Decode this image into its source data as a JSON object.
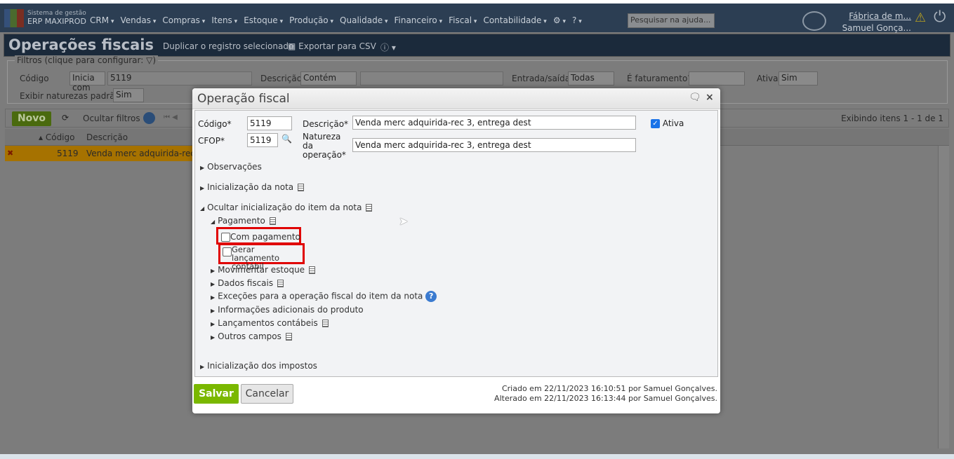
{
  "app": {
    "brand_line1": "Sistema de gestão",
    "brand_line2": "ERP MAXIPROD"
  },
  "nav": {
    "menus": [
      "CRM",
      "Vendas",
      "Compras",
      "Itens",
      "Estoque",
      "Produção",
      "Qualidade",
      "Financeiro",
      "Fiscal",
      "Contabilidade"
    ],
    "help_search_placeholder": "Pesquisar na ajuda...",
    "company": "Fábrica de m...",
    "user": "Samuel Gonça..."
  },
  "page": {
    "title": "Operações fiscais",
    "duplicate": "Duplicar o registro selecionado",
    "export_csv": "Exportar para CSV"
  },
  "filters": {
    "legend": "Filtros (clique para configurar:",
    "codigo_label": "Código",
    "codigo_op": "Inicia com",
    "codigo_value": "5119",
    "descricao_label": "Descrição",
    "descricao_op": "Contém",
    "descricao_value": "",
    "entrada_label": "Entrada/saída",
    "entrada_value": "Todas",
    "faturamento_label": "É faturamento?",
    "faturamento_value": "",
    "ativa_label": "Ativa",
    "ativa_value": "Sim",
    "naturezas_label": "Exibir naturezas padrão",
    "naturezas_value": "Sim"
  },
  "toolbar": {
    "novo": "Novo",
    "hide_filters": "Ocultar filtros",
    "paging": "Exibindo itens 1 - 1 de 1"
  },
  "grid": {
    "columns": [
      "Código",
      "Descrição"
    ],
    "rows": [
      {
        "codigo": "5119",
        "descricao": "Venda merc adquirida-rec 3"
      }
    ]
  },
  "modal": {
    "title": "Operação fiscal",
    "codigo_label": "Código*",
    "codigo": "5119",
    "cfop_label": "CFOP*",
    "cfop": "5119",
    "descricao_label": "Descrição*",
    "descricao": "Venda merc adquirida-rec 3, entrega dest",
    "natureza_label": "Natureza da operação*",
    "natureza": "Venda merc adquirida-rec 3, entrega dest",
    "ativa_label": "Ativa",
    "ativa_checked": true,
    "sections": {
      "observacoes": "Observações",
      "inicializacao_nota": "Inicialização da nota",
      "ocultar_item": "Ocultar inicialização do item da nota",
      "pagamento": "Pagamento",
      "com_pagamento": "Com pagamento",
      "gerar_lancamento": "Gerar lançamento contábil",
      "movimentar_estoque": "Movimentar estoque",
      "dados_fiscais": "Dados fiscais",
      "excecoes": "Exceções para a operação fiscal do item da nota",
      "info_adicionais": "Informações adicionais do produto",
      "lancamentos": "Lançamentos contábeis",
      "outros": "Outros campos",
      "impostos": "Inicialização dos impostos"
    },
    "save": "Salvar",
    "cancel": "Cancelar",
    "created": "Criado em 22/11/2023 16:10:51 por Samuel Gonçalves.",
    "modified": "Alterado em 22/11/2023 16:13:44 por Samuel Gonçalves."
  }
}
